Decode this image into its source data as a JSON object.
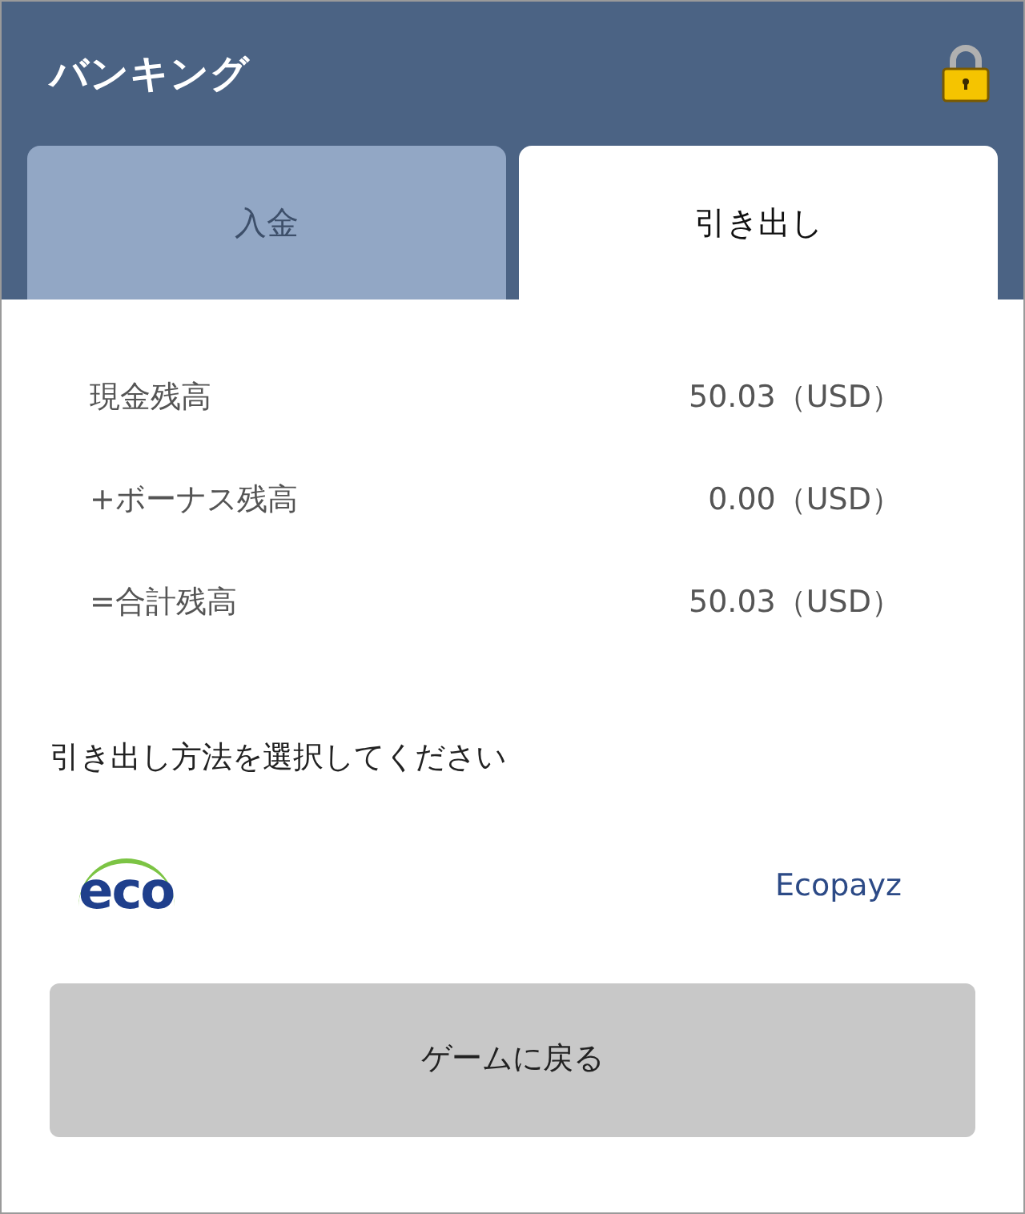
{
  "header": {
    "title": "バンキング"
  },
  "tabs": [
    {
      "label": "入金",
      "selected": false
    },
    {
      "label": "引き出し",
      "selected": true
    }
  ],
  "balances": [
    {
      "label": "現金残高",
      "value": "50.03（USD）"
    },
    {
      "label": "+ボーナス残高",
      "value": "0.00（USD）"
    },
    {
      "label": "=合計残高",
      "value": "50.03（USD）"
    }
  ],
  "prompt": "引き出し方法を選択してください",
  "methods": [
    {
      "logo": "eco",
      "name": "Ecopayz"
    }
  ],
  "back_button": "ゲームに戻る"
}
